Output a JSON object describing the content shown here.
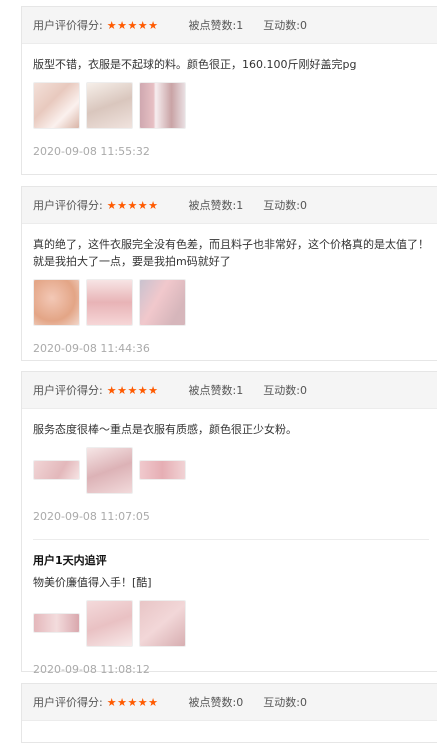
{
  "reviews": [
    {
      "score_label": "用户评价得分:",
      "stars": "★★★★★",
      "likes": "被点赞数:1",
      "interactions": "互动数:0",
      "text": "版型不错，衣服是不起球的料。颜色很正，160.100斤刚好盖完pg",
      "date": "2020-09-08 11:55:32",
      "images": [
        "photo-thumbnail",
        "photo-thumbnail",
        "photo-thumbnail"
      ]
    },
    {
      "score_label": "用户评价得分:",
      "stars": "★★★★★",
      "likes": "被点赞数:1",
      "interactions": "互动数:0",
      "text": "真的绝了，这件衣服完全没有色差，而且料子也非常好，这个价格真的是太值了！就是我拍大了一点，要是我拍m码就好了",
      "date": "2020-09-08 11:44:36",
      "images": [
        "photo-thumbnail",
        "photo-thumbnail",
        "photo-thumbnail"
      ]
    },
    {
      "score_label": "用户评价得分:",
      "stars": "★★★★★",
      "likes": "被点赞数:1",
      "interactions": "互动数:0",
      "text": "服务态度很棒～重点是衣服有质感，颜色很正少女粉。",
      "date": "2020-09-08 11:07:05",
      "images": [
        "photo-thumbnail",
        "photo-thumbnail",
        "photo-thumbnail"
      ],
      "followup": {
        "title": "用户1天内追评",
        "text": "物美价廉值得入手！[酷]",
        "date": "2020-09-08 11:08:12",
        "images": [
          "photo-thumbnail",
          "photo-thumbnail",
          "photo-thumbnail"
        ]
      }
    },
    {
      "score_label": "用户评价得分:",
      "stars": "★★★★★",
      "likes": "被点赞数:0",
      "interactions": "互动数:0"
    }
  ],
  "colors": {
    "star": "#ff5a00",
    "header_bg": "#f5f5f5",
    "date": "#aaaaaa"
  }
}
